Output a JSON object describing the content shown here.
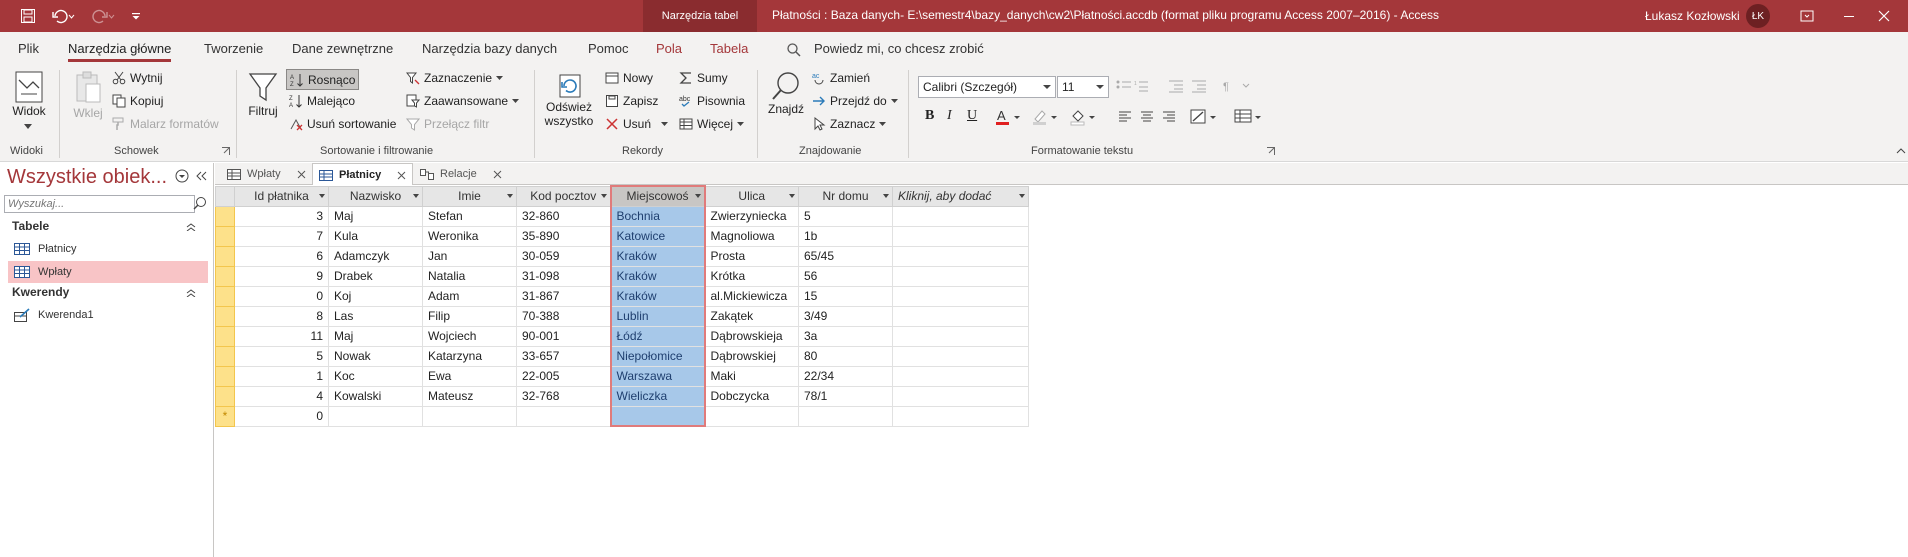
{
  "titlebar": {
    "context_tools": "Narzędzia tabel",
    "window_title": "Płatności : Baza danych- E:\\semestr4\\bazy_danych\\cw2\\Płatności.accdb (format pliku programu Access 2007–2016)  -  Access",
    "user_name": "Łukasz Kozłowski",
    "user_initials": "ŁK"
  },
  "menu": {
    "tabs": [
      "Plik",
      "Narzędzia główne",
      "Tworzenie",
      "Dane zewnętrzne",
      "Narzędzia bazy danych",
      "Pomoc",
      "Pola",
      "Tabela"
    ],
    "active": "Narzędzia główne",
    "tell_me": "Powiedz mi, co chcesz zrobić"
  },
  "ribbon": {
    "widoki": {
      "label": "Widoki",
      "view": "Widok"
    },
    "schowek": {
      "label": "Schowek",
      "paste": "Wklej",
      "cut": "Wytnij",
      "copy": "Kopiuj",
      "painter": "Malarz formatów"
    },
    "sort": {
      "label": "Sortowanie i filtrowanie",
      "filter": "Filtruj",
      "asc": "Rosnąco",
      "desc": "Malejąco",
      "remove": "Usuń sortowanie",
      "selection": "Zaznaczenie",
      "advanced": "Zaawansowane",
      "toggle": "Przełącz filtr"
    },
    "records": {
      "label": "Rekordy",
      "refresh": "Odśwież wszystko",
      "new": "Nowy",
      "save": "Zapisz",
      "delete": "Usuń",
      "totals": "Sumy",
      "spelling": "Pisownia",
      "more": "Więcej"
    },
    "find": {
      "label": "Znajdowanie",
      "find": "Znajdź",
      "replace": "Zamień",
      "goto": "Przejdź do",
      "select": "Zaznacz"
    },
    "format": {
      "label": "Formatowanie tekstu",
      "font": "Calibri (Szczegół)",
      "size": "11",
      "bold": "B",
      "italic": "I",
      "underline": "U"
    }
  },
  "nav": {
    "title": "Wszystkie obiek...",
    "search_placeholder": "Wyszukaj...",
    "groups": [
      {
        "name": "Tabele",
        "items": [
          "Płatnicy",
          "Wpłaty"
        ]
      },
      {
        "name": "Kwerendy",
        "items": [
          "Kwerenda1"
        ]
      }
    ]
  },
  "doc_tabs": [
    "Wpłaty",
    "Płatnicy",
    "Relacje"
  ],
  "active_doc_tab": "Płatnicy",
  "table": {
    "columns": [
      "Id płatnika",
      "Nazwisko",
      "Imie",
      "Kod pocztov",
      "Miejscowoś",
      "Ulica",
      "Nr domu",
      "Kliknij, aby dodać"
    ],
    "rows": [
      [
        "3",
        "Maj",
        "Stefan",
        "32-860",
        "Bochnia",
        "Zwierzyniecka",
        "5"
      ],
      [
        "7",
        "Kula",
        "Weronika",
        "35-890",
        "Katowice",
        "Magnoliowa",
        "1b"
      ],
      [
        "6",
        "Adamczyk",
        "Jan",
        "30-059",
        "Kraków",
        "Prosta",
        "65/45"
      ],
      [
        "9",
        "Drabek",
        "Natalia",
        "31-098",
        "Kraków",
        "Krótka",
        "56"
      ],
      [
        "0",
        "Koj",
        "Adam",
        "31-867",
        "Kraków",
        "al.Mickiewicza",
        "15"
      ],
      [
        "8",
        "Las",
        "Filip",
        "70-388",
        "Lublin",
        "Zakątek",
        "3/49"
      ],
      [
        "11",
        "Maj",
        "Wojciech",
        "90-001",
        "Łódź",
        "Dąbrowskieja",
        "3a"
      ],
      [
        "5",
        "Nowak",
        "Katarzyna",
        "33-657",
        "Niepołomice",
        "Dąbrowskiej",
        "80"
      ],
      [
        "1",
        "Koc",
        "Ewa",
        "22-005",
        "Warszawa",
        "Maki",
        "22/34"
      ],
      [
        "4",
        "Kowalski",
        "Mateusz",
        "32-768",
        "Wieliczka",
        "Dobczycka",
        "78/1"
      ]
    ],
    "new_row_id": "0",
    "new_row_marker": "*"
  },
  "colors": {
    "accent": "#a4373a",
    "selection": "#a7c8e9",
    "row_selector": "#fde18a"
  }
}
